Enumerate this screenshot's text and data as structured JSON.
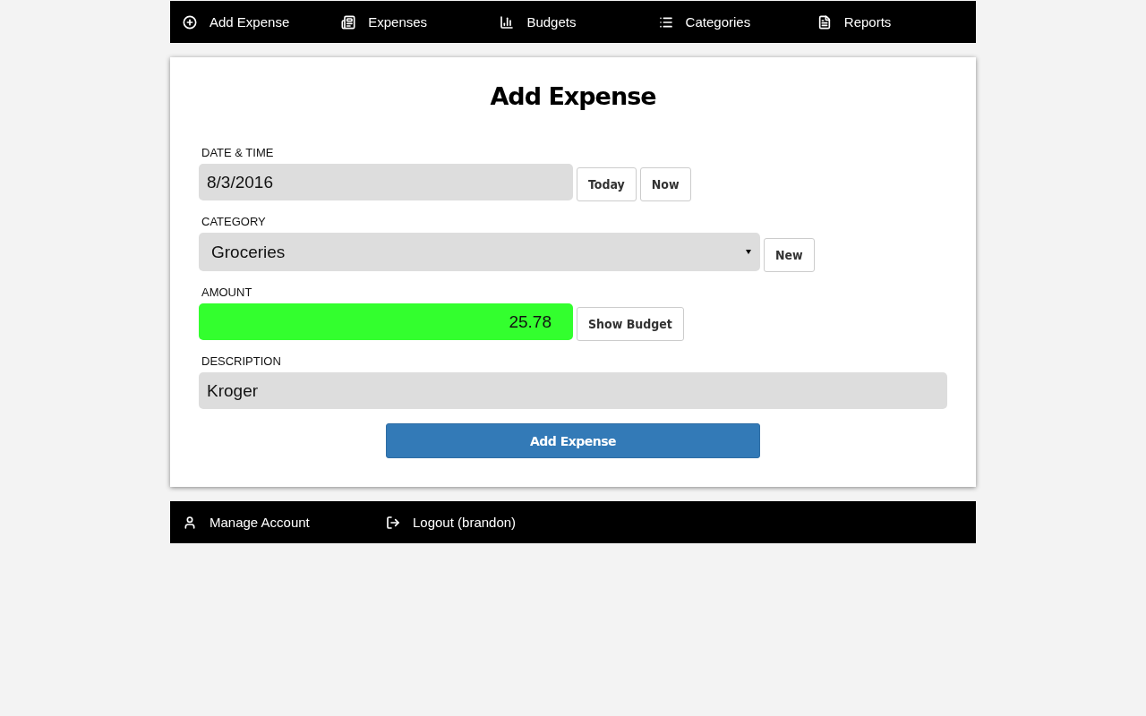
{
  "nav": [
    {
      "label": "Add Expense"
    },
    {
      "label": "Expenses"
    },
    {
      "label": "Budgets"
    },
    {
      "label": "Categories"
    },
    {
      "label": "Reports"
    }
  ],
  "form": {
    "title": "Add Expense",
    "fields": [
      {
        "kind": "date",
        "label": "DATE & TIME",
        "value": "8/3/2016",
        "buttons": [
          "Today",
          "Now"
        ]
      },
      {
        "kind": "select",
        "label": "CATEGORY",
        "value": "Groceries",
        "buttons": [
          "New"
        ]
      },
      {
        "kind": "amount",
        "label": "AMOUNT",
        "value": "25.78",
        "color": "#33ff2e",
        "buttons": [
          "Show Budget"
        ]
      },
      {
        "kind": "text",
        "label": "DESCRIPTION",
        "value": "Kroger"
      }
    ],
    "submit": "Add Expense"
  },
  "footer": [
    {
      "label": "Manage Account"
    },
    {
      "label": "Logout (brandon)"
    }
  ]
}
